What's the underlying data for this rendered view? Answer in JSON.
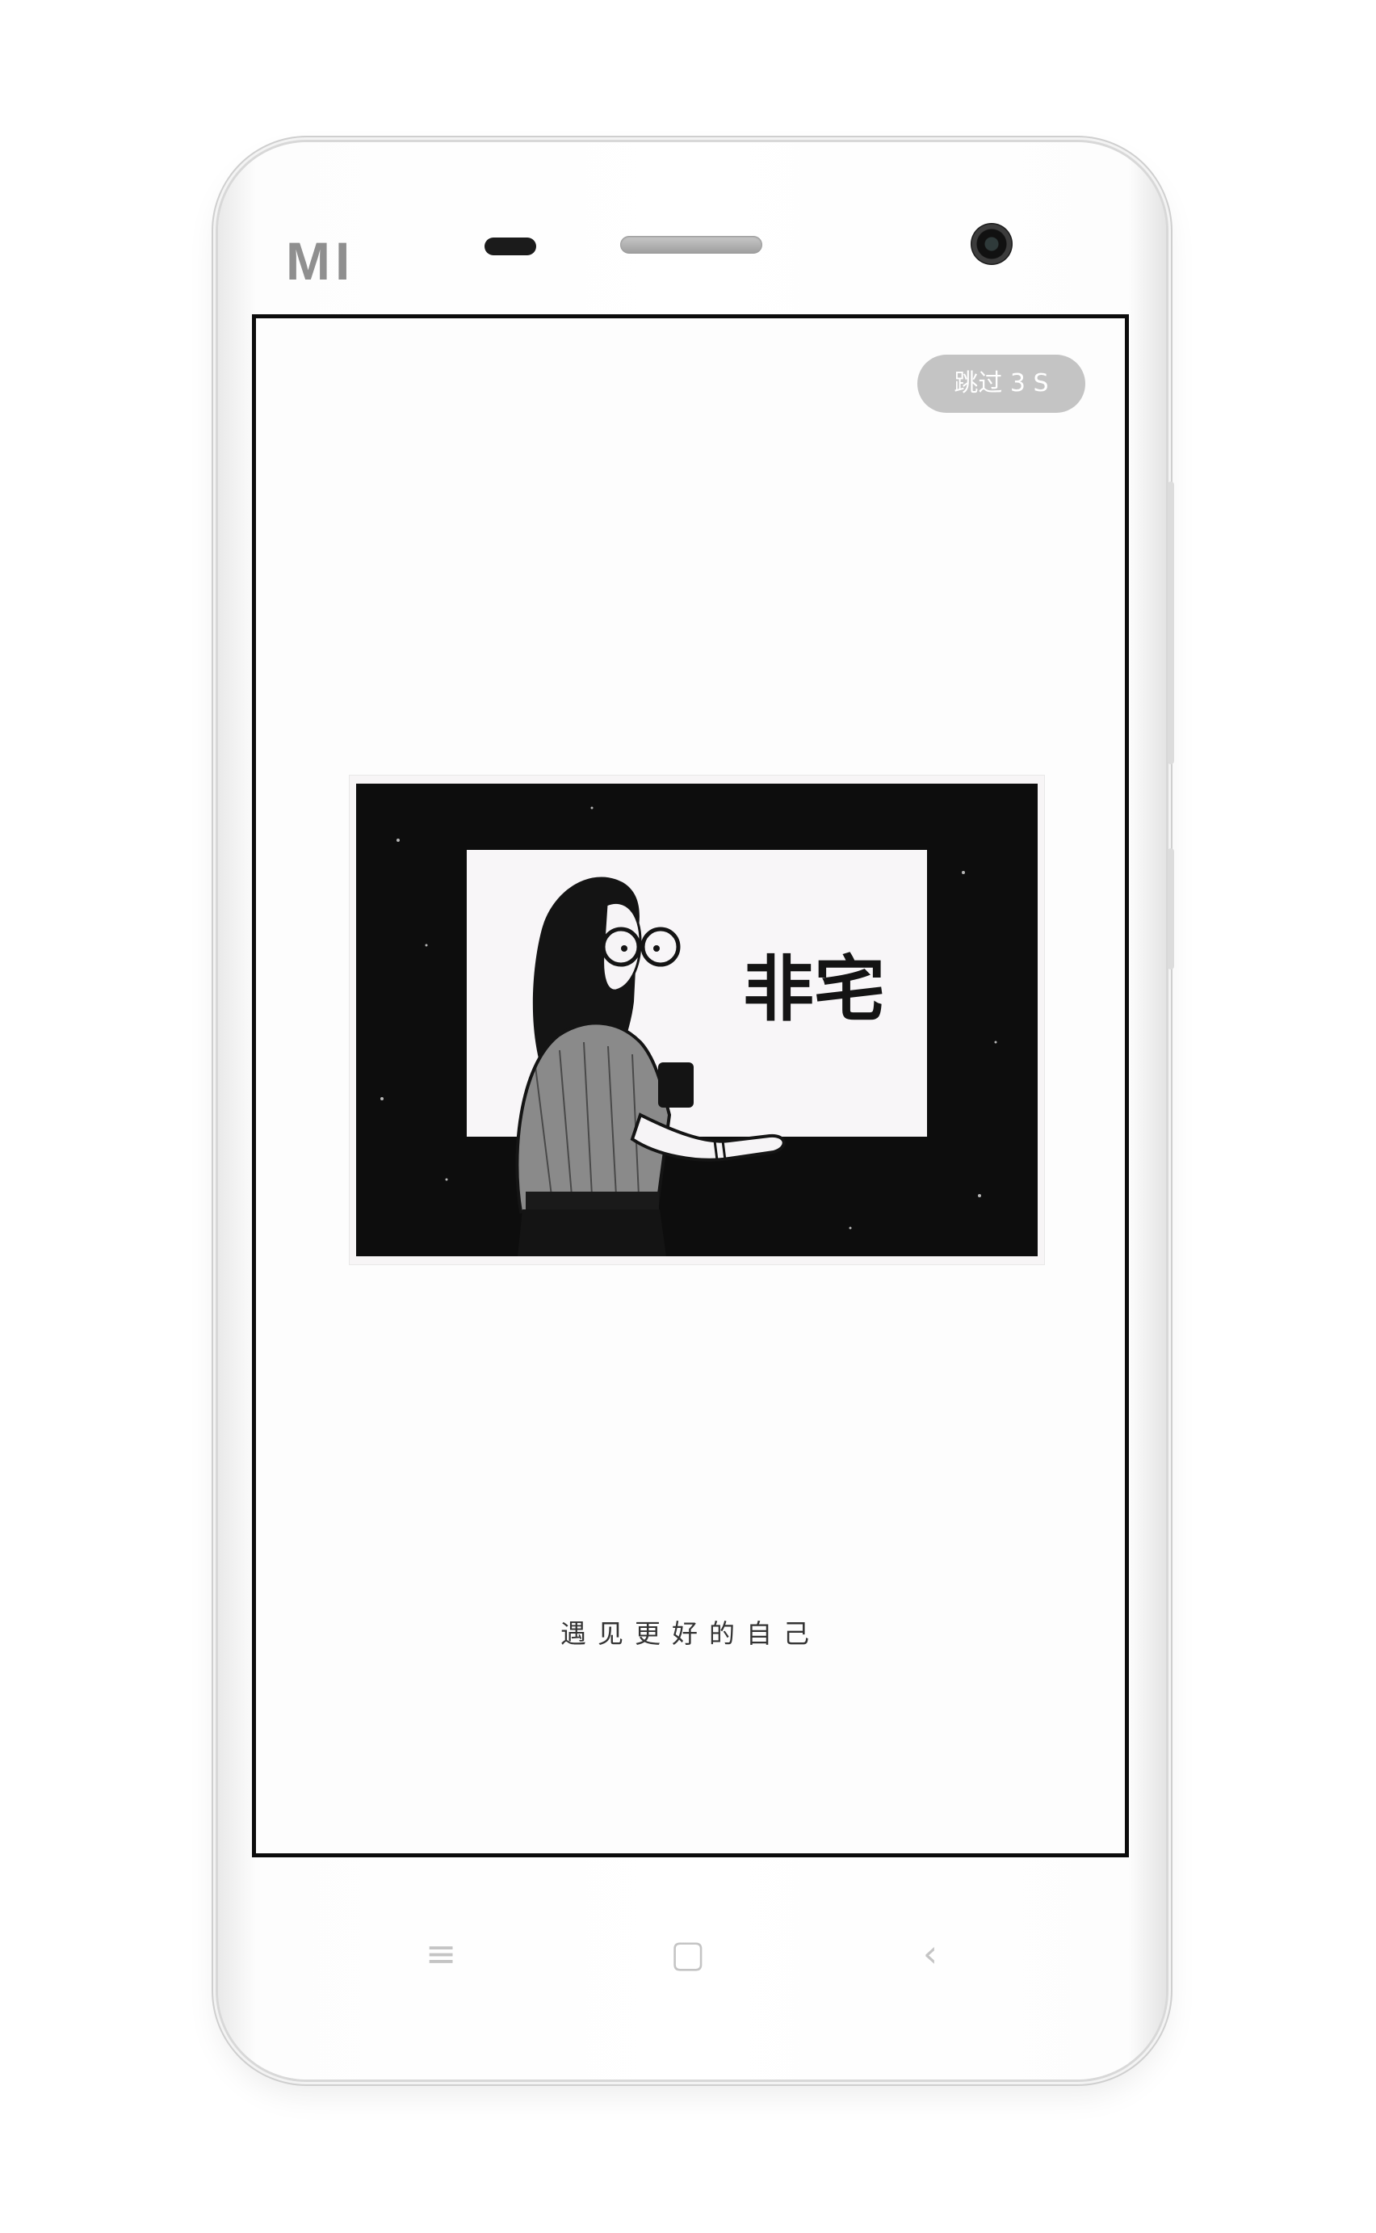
{
  "device": {
    "brand_logo": "MI"
  },
  "splash": {
    "skip_label": "跳过 3 S",
    "image_text": "非宅",
    "slogan": "遇见更好的自己"
  },
  "nav_keys": {
    "menu_glyph": "≡",
    "home_glyph": "▢",
    "back_glyph": "‹"
  }
}
